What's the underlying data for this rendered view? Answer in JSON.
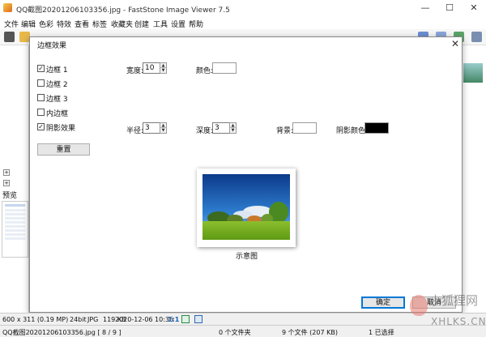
{
  "window": {
    "title": "QQ截图20201206103356.jpg - FastStone Image Viewer 7.5",
    "controls": [
      "—",
      "☐",
      "✕"
    ]
  },
  "menu": [
    "文件",
    "编辑",
    "色彩",
    "特效",
    "查看",
    "标签",
    "收藏夹",
    "创建",
    "工具",
    "设置",
    "帮助"
  ],
  "dialog": {
    "title": "边框效果",
    "options": [
      {
        "label": "边框 1",
        "checked": true
      },
      {
        "label": "边框 2",
        "checked": false
      },
      {
        "label": "边框 3",
        "checked": false
      },
      {
        "label": "内边框",
        "checked": false
      },
      {
        "label": "阴影效果",
        "checked": true
      }
    ],
    "width_label": "宽度:",
    "width_value": "10",
    "color_label": "颜色:",
    "color_value": "#ffffff",
    "radius_label": "半径:",
    "radius_value": "3",
    "depth_label": "深度:",
    "depth_value": "3",
    "bg_label": "背景:",
    "bg_value": "#ffffff",
    "shadow_color_label": "阴影颜色:",
    "shadow_color_value": "#000000",
    "reset_button": "重置",
    "preview_caption": "示意图",
    "ok_button": "确定",
    "cancel_button": "取消"
  },
  "status": {
    "dims": "600 x 311 (0.19 MP)",
    "bits": "24bit",
    "format": "JPG",
    "size": "119 KB",
    "datetime": "2020-12-06 10:36",
    "zoom": "1:1",
    "file": "QQ截图20201206103356.jpg [ 8 / 9 ]",
    "folders": "0 个文件夹",
    "files": "9 个文件 (207 KB)",
    "selected": "1 已选择"
  },
  "left_panel": {
    "preview_label": "预览"
  },
  "watermark": {
    "cn": "小狐狸网",
    "en": "XHLKS.CN"
  }
}
